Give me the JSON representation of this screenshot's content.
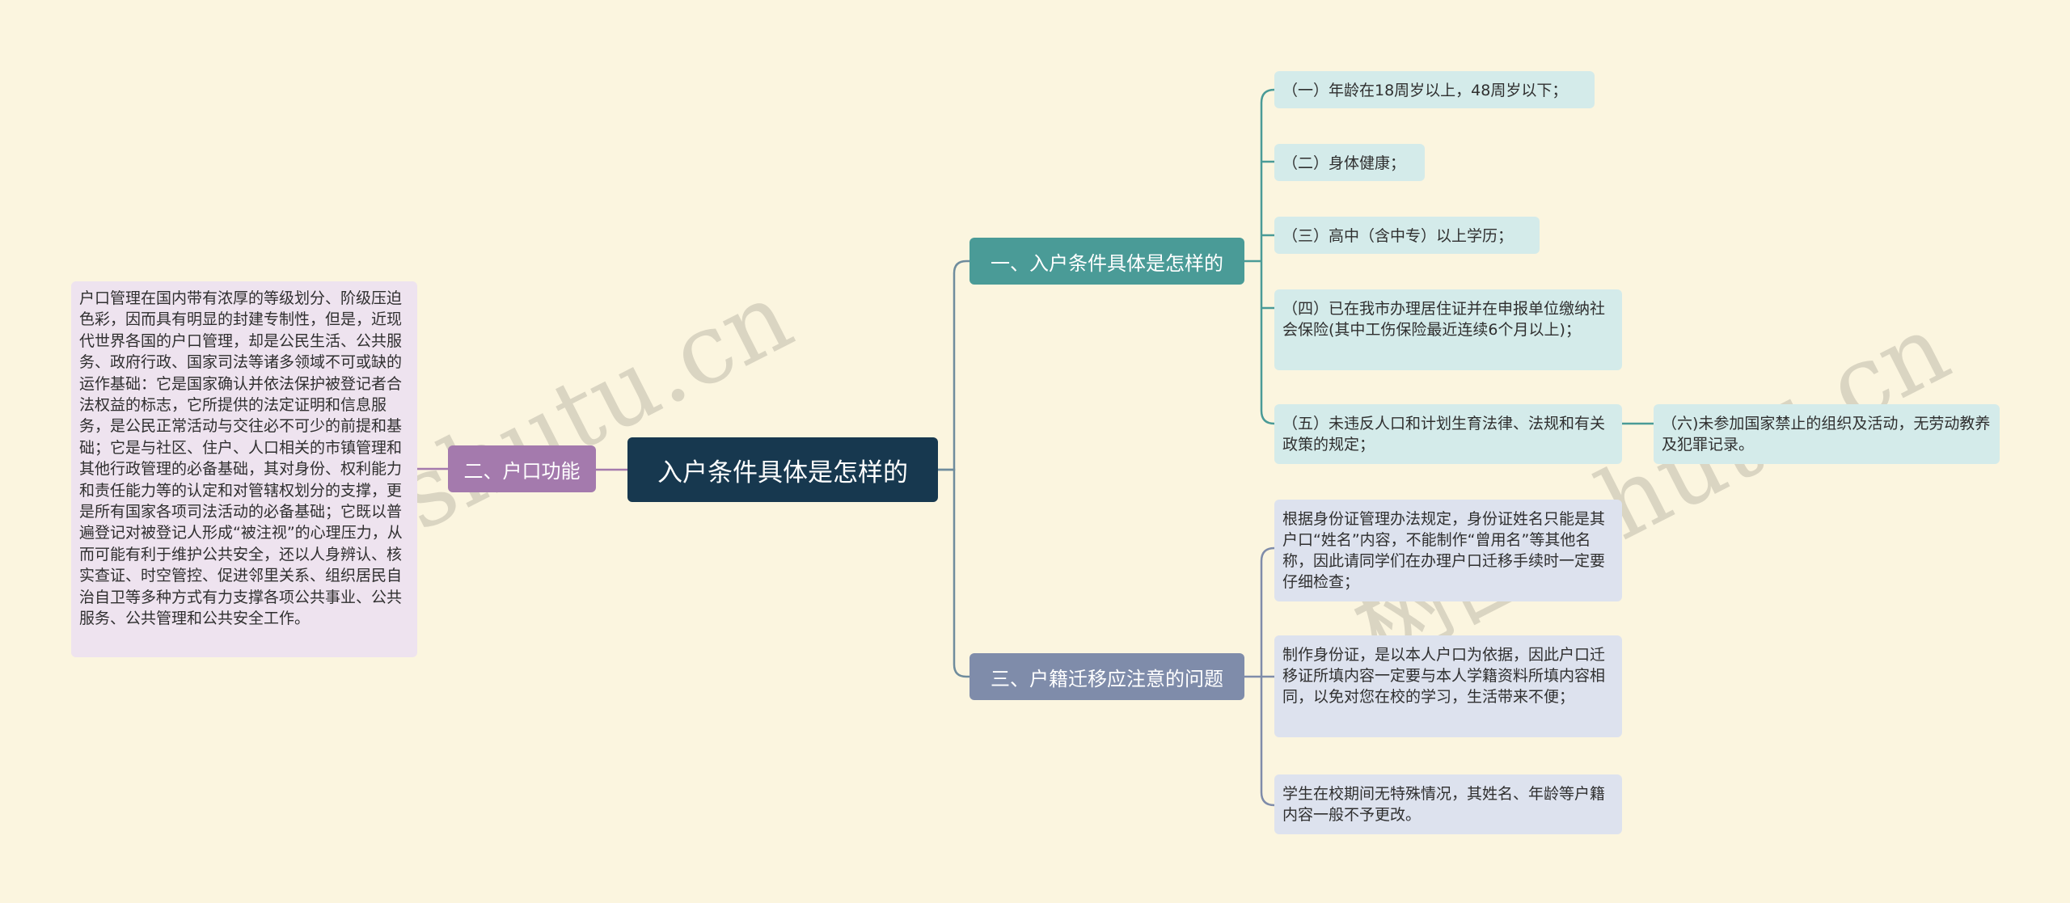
{
  "root": {
    "label": "入户条件具体是怎样的"
  },
  "branches": [
    {
      "label": "一、入户条件具体是怎样的",
      "children": [
        "（一）年龄在18周岁以上，48周岁以下；",
        "（二）身体健康；",
        "（三）高中（含中专）以上学历；",
        "（四）已在我市办理居住证并在申报单位缴纳社会保险(其中工伤保险最近连续6个月以上)；",
        "（五）未违反人口和计划生育法律、法规和有关政策的规定；"
      ],
      "extra": "（六)未参加国家禁止的组织及活动，无劳动教养及犯罪记录。"
    },
    {
      "label": "二、户口功能",
      "children": [
        "户口管理在国内带有浓厚的等级划分、阶级压迫色彩，因而具有明显的封建专制性，但是，近现代世界各国的户口管理，却是公民生活、公共服务、政府行政、国家司法等诸多领域不可或缺的运作基础：它是国家确认并依法保护被登记者合法权益的标志，它所提供的法定证明和信息服务，是公民正常活动与交往必不可少的前提和基础；它是与社区、住户、人口相关的市镇管理和其他行政管理的必备基础，其对身份、权利能力和责任能力等的认定和对管辖权划分的支撑，更是所有国家各项司法活动的必备基础；它既以普遍登记对被登记人形成“被注视”的心理压力，从而可能有利于维护公共安全，还以人身辨认、核实查证、时空管控、促进邻里关系、组织居民自治自卫等多种方式有力支撑各项公共事业、公共服务、公共管理和公共安全工作。"
      ]
    },
    {
      "label": "三、户籍迁移应注意的问题",
      "children": [
        "根据身份证管理办法规定，身份证姓名只能是其户口“姓名”内容，不能制作“曾用名”等其他名称，因此请同学们在办理户口迁移手续时一定要仔细检查；",
        "制作身份证，是以本人户口为依据，因此户口迁移证所填内容一定要与本人学籍资料所填内容相同，以免对您在校的学习，生活带来不便；",
        "学生在校期间无特殊情况，其姓名、年龄等户籍内容一般不予更改。"
      ]
    }
  ],
  "watermarks": [
    "shutu.cn",
    "树图 shutu.cn"
  ],
  "colors": {
    "background": "#fbf5df",
    "root": "#17384f",
    "branch1": "#4a9b97",
    "branch2": "#a47aad",
    "branch3": "#7f8caa"
  }
}
